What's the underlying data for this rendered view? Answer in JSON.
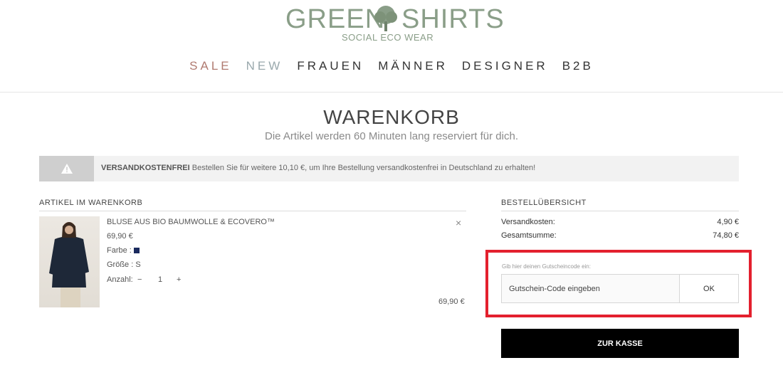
{
  "brand": {
    "word1": "GREEN",
    "word2": "SHIRTS",
    "tagline": "SOCIAL ECO WEAR",
    "color": "#8a9e88"
  },
  "nav": {
    "sale": "SALE",
    "new": "NEW",
    "frauen": "FRAUEN",
    "maenner": "MÄNNER",
    "designer": "DESIGNER",
    "b2b": "B2B"
  },
  "cart": {
    "title": "WARENKORB",
    "subtitle": "Die Artikel werden 60 Minuten lang reserviert für dich.",
    "notice_bold": "VERSANDKOSTENFREI",
    "notice_text": " Bestellen Sie für weitere 10,10 €, um Ihre Bestellung versandkostenfrei in Deutschland zu erhalten!",
    "notice_icon": "warning-icon",
    "items_heading": "ARTIKEL IM WARENKORB"
  },
  "product": {
    "name": "BLUSE AUS BIO BAUMWOLLE & ECOVERO™",
    "price": "69,90 €",
    "color_label": "Farbe :",
    "color_value": "#1a2a5e",
    "size_label": "Größe :",
    "size_value": "S",
    "qty_label": "Anzahl:",
    "qty_minus": "−",
    "qty_value": "1",
    "qty_plus": "+",
    "line_total": "69,90 €",
    "remove_glyph": "×"
  },
  "summary": {
    "heading": "BESTELLÜBERSICHT",
    "shipping_label": "Versandkosten:",
    "shipping_value": "4,90 €",
    "total_label": "Gesamtsumme:",
    "total_value": "74,80 €"
  },
  "coupon": {
    "label": "Gib hier deinen Gutscheincode ein:",
    "placeholder": "Gutschein-Code eingeben",
    "ok_label": "OK",
    "highlight_color": "#e3202e"
  },
  "checkout": {
    "label": "ZUR KASSE"
  }
}
